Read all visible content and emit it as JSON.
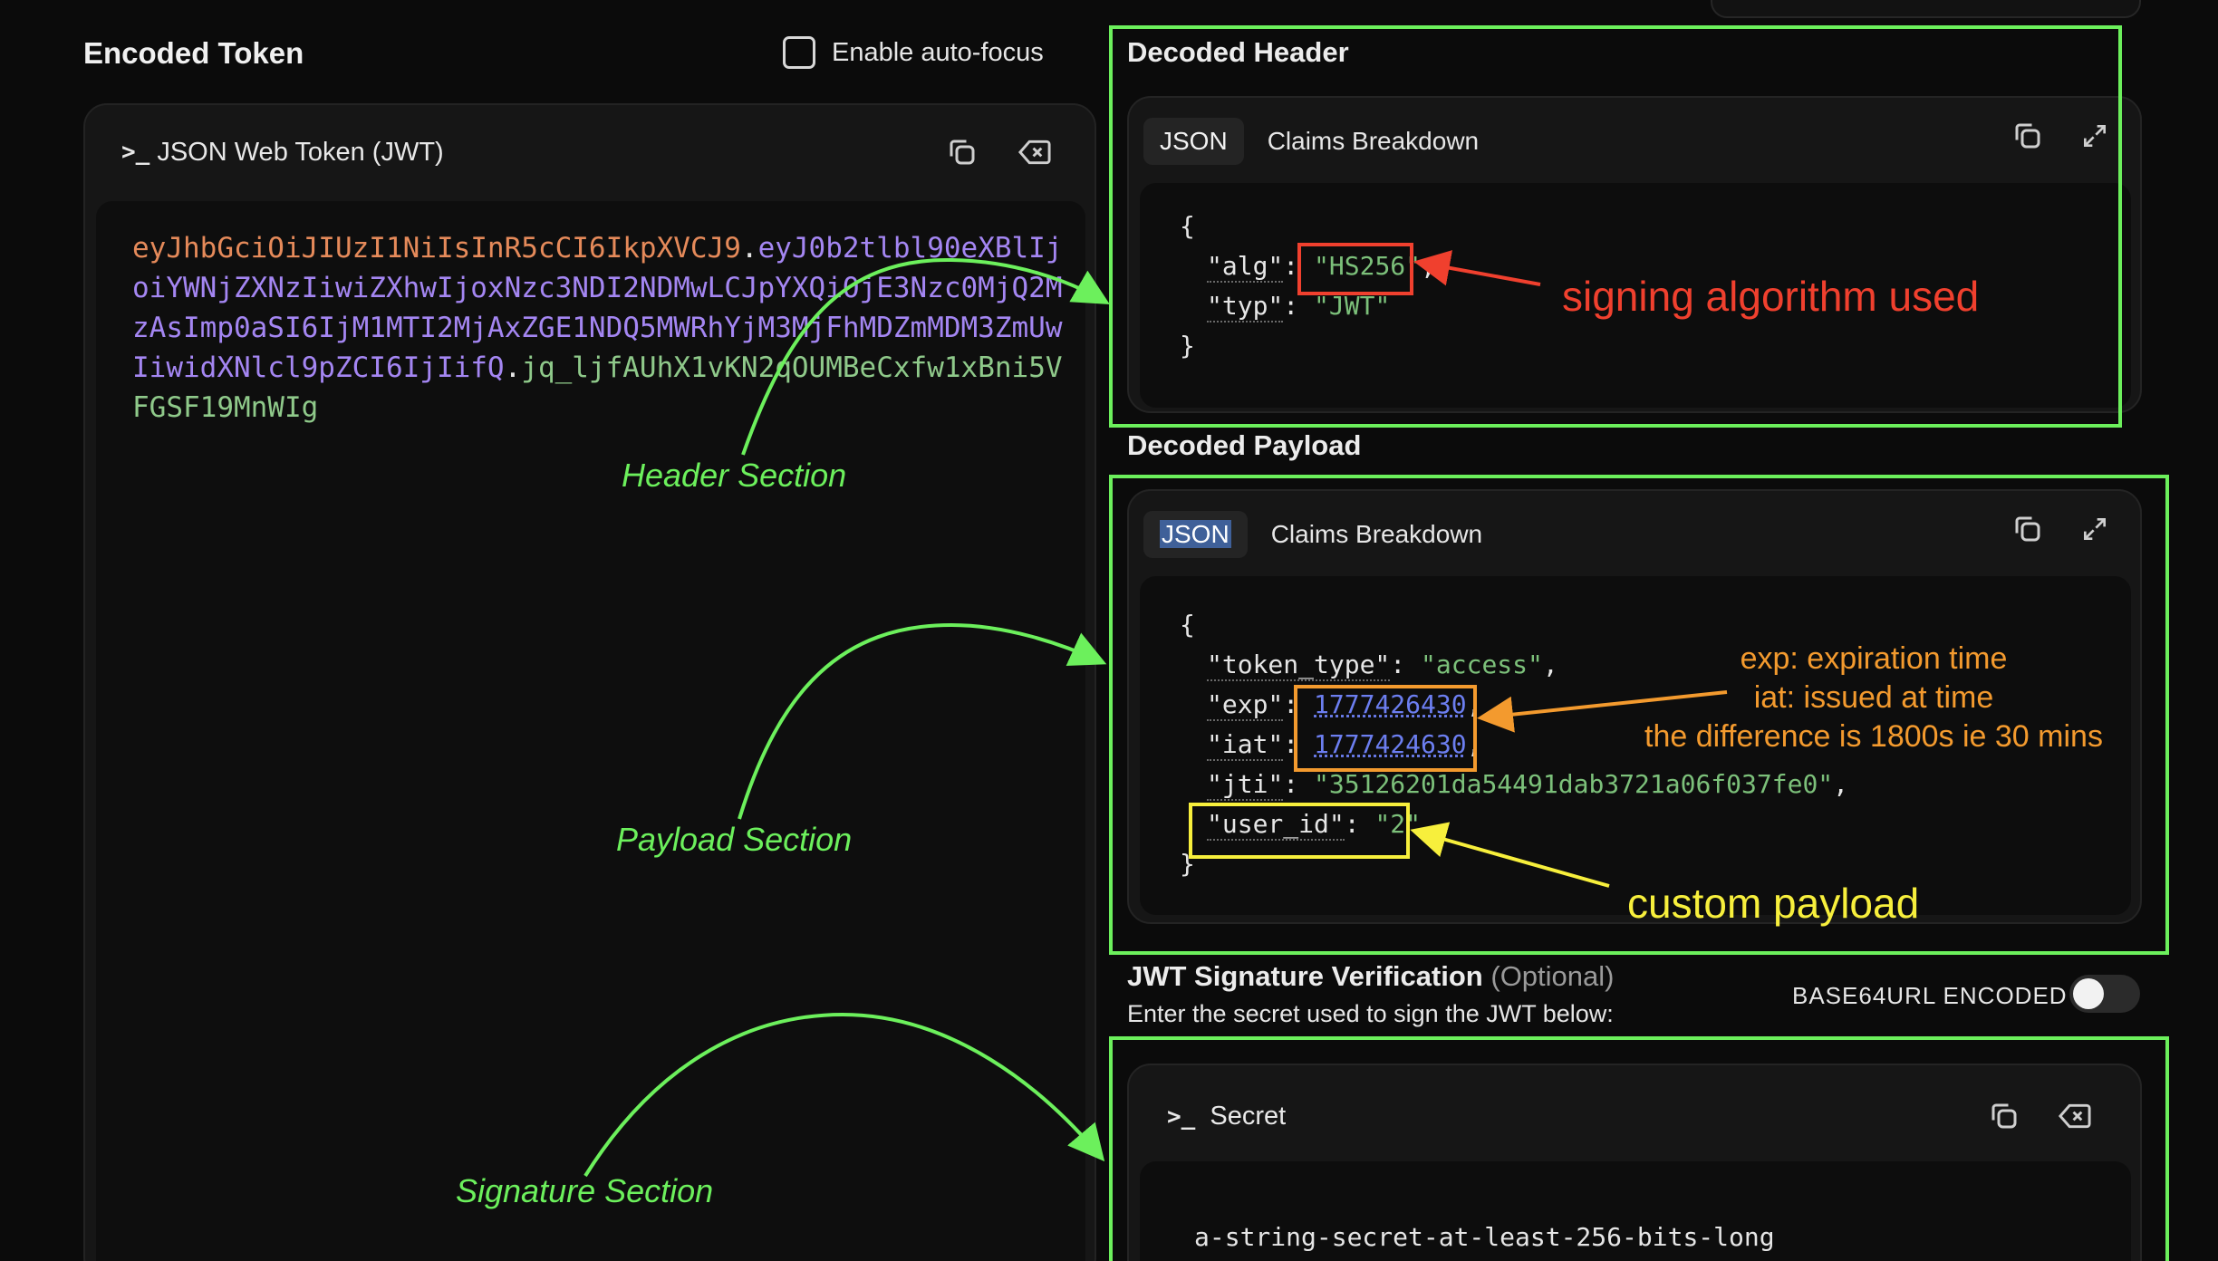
{
  "left": {
    "title": "Encoded Token",
    "autofocus_label": "Enable auto-focus",
    "panel_title": "JSON Web Token (JWT)",
    "prompt_glyph": ">_",
    "token": {
      "header": "eyJhbGciOiJIUzI1NiIsInR5cCI6IkpXVCJ9",
      "payload": "eyJ0b2tlbl90eXBlIjoiYWNjZXNzIiwiZXhwIjoxNzc3NDI2NDMwLCJpYXQiOjE3Nzc0MjQ2MzAsImp0aSI6IjM1MTI2MjAxZGE1NDQ5MWRhYjM3MjFhMDZmMDM3ZmUwIiwidXNlcl9pZCI6IjIifQ",
      "signature": "jq_ljfAUhX1vKN2qOUMBeCxfw1xBni5VFGSF19MnWIg",
      "dot": "."
    }
  },
  "annotations": {
    "header_section": "Header Section",
    "payload_section": "Payload Section",
    "signature_section": "Signature Section",
    "signing_algorithm": "signing algorithm used",
    "exp_note": "exp: expiration time",
    "iat_note": "iat: issued at time",
    "difference_note": "the difference is 1800s ie 30 mins",
    "custom_payload": "custom payload"
  },
  "decoded_header": {
    "title": "Decoded Header",
    "tab_json": "JSON",
    "tab_claims": "Claims Breakdown",
    "open_brace": "{",
    "close_brace": "}",
    "alg_key": "\"alg\"",
    "alg_value": "\"HS256\"",
    "typ_key": "\"typ\"",
    "typ_value": "\"JWT\"",
    "colon": ": ",
    "comma": ","
  },
  "decoded_payload": {
    "title": "Decoded Payload",
    "tab_json": "JSON",
    "tab_claims": "Claims Breakdown",
    "open_brace": "{",
    "close_brace": "}",
    "token_type_key": "\"token_type\"",
    "token_type_value": "\"access\"",
    "exp_key": "\"exp\"",
    "exp_value": "1777426430",
    "iat_key": "\"iat\"",
    "iat_value": "1777424630",
    "jti_key": "\"jti\"",
    "jti_value": "\"35126201da54491dab3721a06f037fe0\"",
    "user_id_key": "\"user_id\"",
    "user_id_value": "\"2\"",
    "colon": ": ",
    "comma": ","
  },
  "signature": {
    "title": "JWT Signature Verification",
    "optional": "(Optional)",
    "subtitle": "Enter the secret used to sign the JWT below:",
    "base64_label": "BASE64URL ENCODED",
    "secret_title": "Secret",
    "prompt_glyph": ">_",
    "secret_value": "a-string-secret-at-least-256-bits-long"
  },
  "colors": {
    "annotation_green": "#6cf05c",
    "annotation_red": "#f0402e",
    "annotation_orange": "#f39a2e",
    "annotation_yellow": "#f7ef3c",
    "jwt_header": "#e58a5a",
    "jwt_payload": "#a486f2",
    "jwt_signature": "#8fc98a"
  }
}
